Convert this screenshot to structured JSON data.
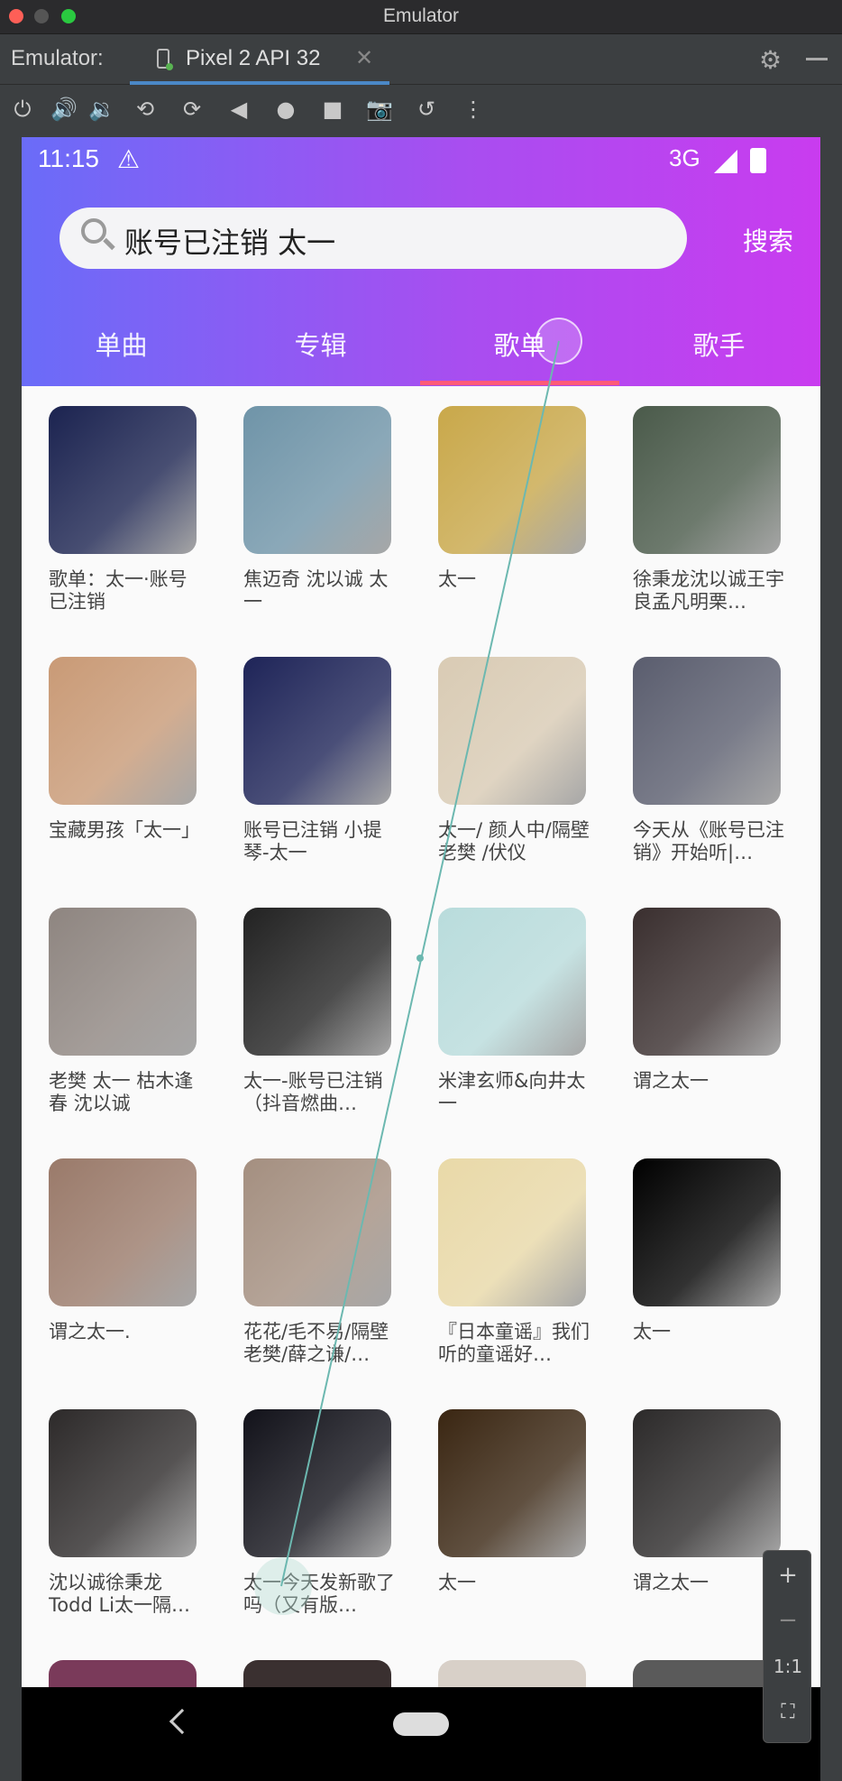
{
  "window": {
    "title": "Emulator"
  },
  "tabbar": {
    "label": "Emulator:",
    "device_tab": "Pixel 2 API 32"
  },
  "toolbar": {
    "icons": [
      "power-icon",
      "volume-up-icon",
      "volume-down-icon",
      "rotate-left-icon",
      "rotate-right-icon",
      "back-icon",
      "home-icon",
      "overview-icon",
      "camera-icon",
      "snapshot-icon",
      "more-icon"
    ]
  },
  "status": {
    "time": "11:15",
    "network": "3G"
  },
  "search": {
    "value": "账号已注销 太一",
    "button": "搜索"
  },
  "tabs": [
    {
      "label": "单曲",
      "selected": false
    },
    {
      "label": "专辑",
      "selected": false
    },
    {
      "label": "歌单",
      "selected": true
    },
    {
      "label": "歌手",
      "selected": false
    }
  ],
  "playlists": [
    {
      "title": "歌单：太一·账号已注销",
      "color": "#1b2350"
    },
    {
      "title": "焦迈奇 沈以诚 太一",
      "color": "#6f94a8"
    },
    {
      "title": "太一",
      "color": "#c9a84a"
    },
    {
      "title": "徐秉龙沈以诚王宇良孟凡明栗…",
      "color": "#4a5a4a"
    },
    {
      "title": "宝藏男孩「太一」",
      "color": "#c99a76"
    },
    {
      "title": "账号已注销 小提琴-太一",
      "color": "#1e2458"
    },
    {
      "title": "太一/ 颜人中/隔壁老樊 /伏仪",
      "color": "#d9cbb4"
    },
    {
      "title": "今天从《账号已注销》开始听|…",
      "color": "#5a5d6e"
    },
    {
      "title": "老樊 太一 枯木逢春 沈以诚",
      "color": "#8e8580"
    },
    {
      "title": "太一-账号已注销（抖音燃曲…",
      "color": "#222222"
    },
    {
      "title": "米津玄师&向井太一",
      "color": "#b9dcdc"
    },
    {
      "title": "谓之太一",
      "color": "#3a2f2f"
    },
    {
      "title": "谓之太一.",
      "color": "#9a7a6a"
    },
    {
      "title": "花花/毛不易/隔壁老樊/薛之谦/…",
      "color": "#a48f80"
    },
    {
      "title": "『日本童谣』我们听的童谣好…",
      "color": "#e9d9a8"
    },
    {
      "title": "太一",
      "color": "#000000"
    },
    {
      "title": "沈以诚徐秉龙Todd Li太一隔…",
      "color": "#2d2a2a"
    },
    {
      "title": "太一今天发新歌了吗（又有版…",
      "color": "#12121a"
    },
    {
      "title": "太一",
      "color": "#3a2612"
    },
    {
      "title": "谓之太一",
      "color": "#2c2a2a"
    }
  ],
  "zoom": {
    "plus": "+",
    "minus": "−",
    "reset": "1:1"
  }
}
